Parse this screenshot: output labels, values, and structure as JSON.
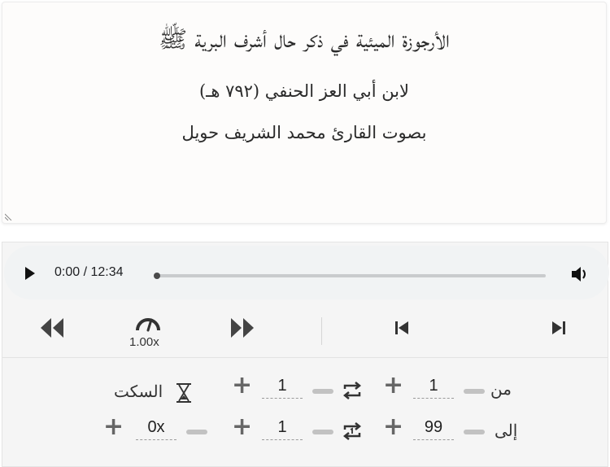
{
  "header": {
    "title": "الأرجوزة الميئية في ذكر حال أشرف البرية ﷺ",
    "author": "لابن أبي العز الحنفي (٧٩٢ هـ)",
    "reciter": "بصوت القارئ محمد الشريف حويل"
  },
  "audio": {
    "time": "0:00 / 12:34",
    "progress": 0
  },
  "controls": {
    "speed": "1.00x"
  },
  "range": {
    "from_label": "من",
    "from_value": "1",
    "to_label": "إلى",
    "to_value": "99",
    "repeat_each_value": "1",
    "repeat_range_value": "1",
    "silence_label": "السكت",
    "silence_value": "0x"
  }
}
